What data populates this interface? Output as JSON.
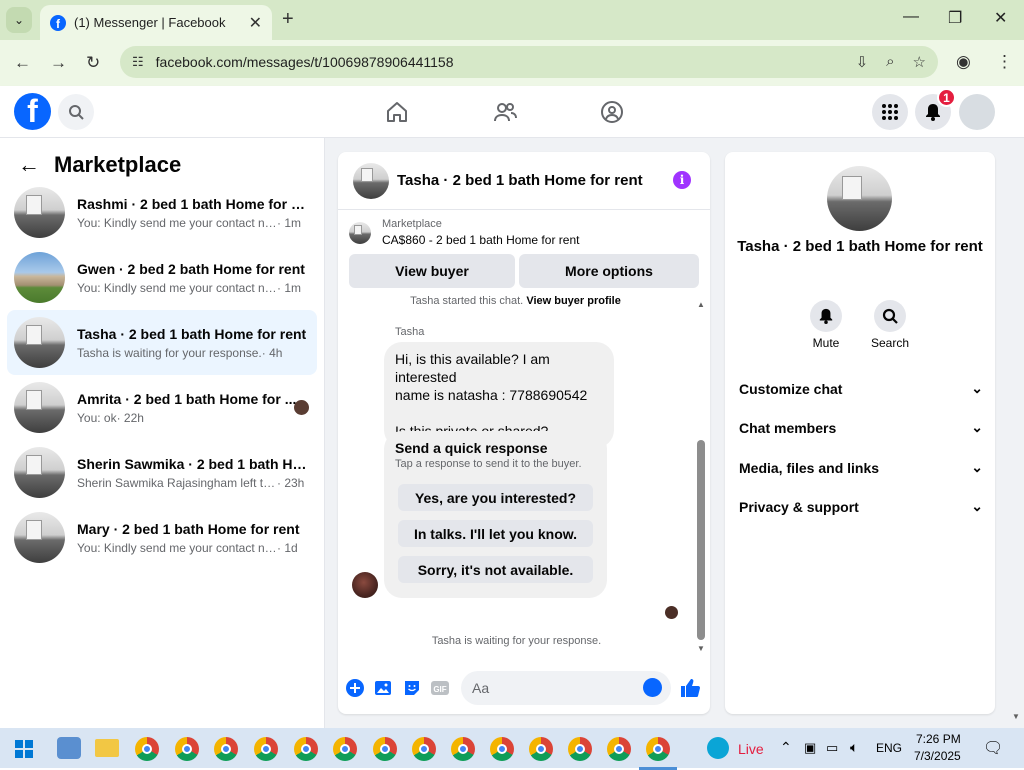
{
  "browser": {
    "tab_title": "(1) Messenger | Facebook",
    "url": "facebook.com/messages/t/10069878906441158"
  },
  "header": {
    "notification_count": "1"
  },
  "sidebar": {
    "title": "Marketplace",
    "conversations": [
      {
        "title": "Rashmi · 2 bed 1 bath Home for rent",
        "preview": "You: Kindly send me your contact nu...",
        "time": "· 1m"
      },
      {
        "title": "Gwen · 2 bed 2 bath Home for rent",
        "preview": "You: Kindly send me your contact nu...",
        "time": "· 1m"
      },
      {
        "title": "Tasha · 2 bed 1 bath Home for rent",
        "preview": "Tasha is waiting for your response.",
        "time": "· 4h"
      },
      {
        "title": "Amrita · 2 bed 1 bath Home for ...",
        "preview": "You: ok",
        "time": "· 22h"
      },
      {
        "title": "Sherin Sawmika · 2 bed 1 bath Ho...",
        "preview": "Sherin Sawmika Rajasingham left the...",
        "time": "· 23h"
      },
      {
        "title": "Mary · 2 bed 1 bath Home for rent",
        "preview": "You: Kindly send me your contact nu...",
        "time": "· 1d"
      }
    ]
  },
  "chat": {
    "title": "Tasha · 2 bed 1 bath Home for rent",
    "marketplace_label": "Marketplace",
    "listing": "CA$860 - 2 bed 1 bath Home for rent",
    "view_buyer": "View buyer",
    "more_options": "More options",
    "started_text": "Tasha started this chat.",
    "view_profile": "View buyer profile",
    "sender": "Tasha",
    "message": "Hi, is this available? I am interested\nname is natasha : 7788690542\n\nIs this private or shared?",
    "quick_title": "Send a quick response",
    "quick_sub": "Tap a response to send it to the buyer.",
    "quick_responses": [
      "Yes, are you interested?",
      "In talks. I'll let you know.",
      "Sorry, it's not available."
    ],
    "waiting": "Tasha is waiting for your response.",
    "input_placeholder": "Aa"
  },
  "info_panel": {
    "name": "Tasha · 2 bed 1 bath Home for rent",
    "mute": "Mute",
    "search": "Search",
    "sections": [
      "Customize chat",
      "Chat members",
      "Media, files and links",
      "Privacy & support"
    ]
  },
  "taskbar": {
    "live": "Live",
    "lang": "ENG",
    "time": "7:26 PM",
    "date": "7/3/2025"
  }
}
